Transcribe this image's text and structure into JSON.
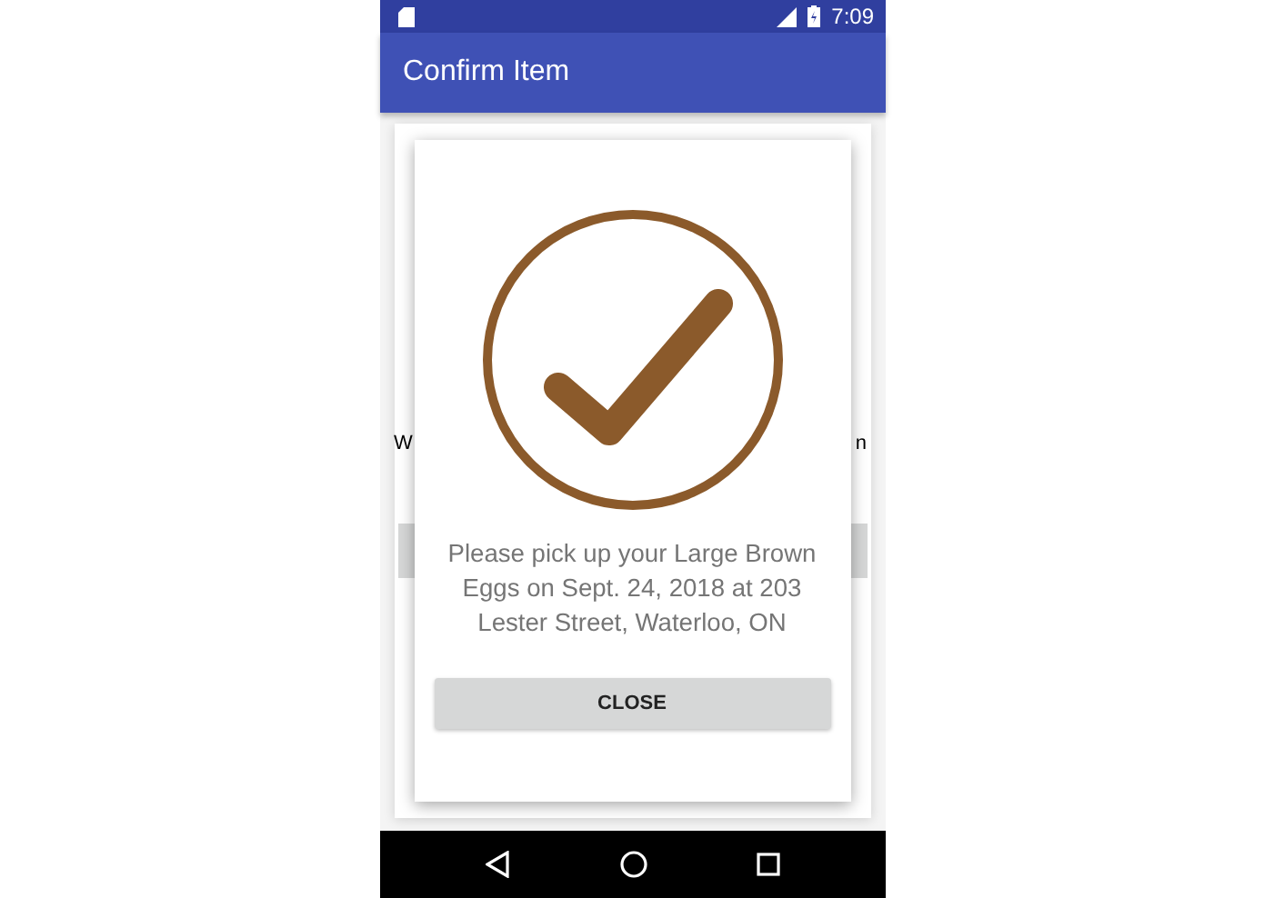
{
  "status_bar": {
    "time": "7:09"
  },
  "app_bar": {
    "title": "Confirm Item"
  },
  "background": {
    "text_left": "W",
    "text_right": "n"
  },
  "dialog": {
    "message": "Please pick up your Large Brown Eggs on Sept. 24, 2018 at 203 Lester Street, Waterloo, ON",
    "button": "CLOSE"
  }
}
